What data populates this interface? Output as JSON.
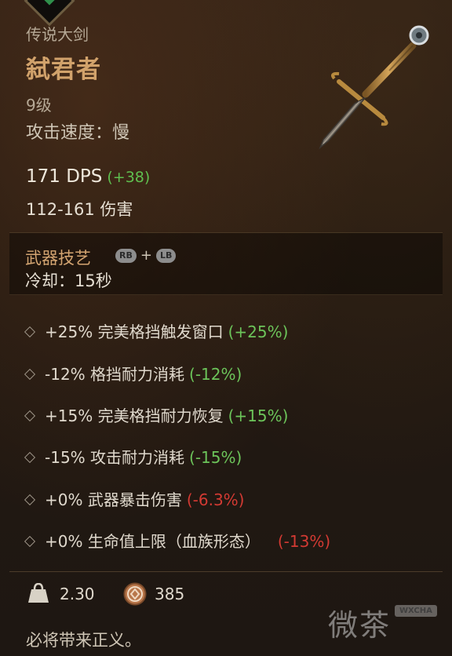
{
  "item": {
    "subtype": "传说大剑",
    "name": "弑君者",
    "level": "9级",
    "attack_speed": "攻击速度：慢",
    "dps": "171 DPS",
    "dps_bonus": "(+38)",
    "damage": "112-161 伤害"
  },
  "skill": {
    "title": "武器技艺",
    "button1": "RB",
    "plus": "+",
    "button2": "LB",
    "cooldown": "冷却：15秒"
  },
  "affixes": [
    {
      "text": "+25% 完美格挡触发窗口",
      "delta": "(+25%)",
      "delta_color": "#6cc45a"
    },
    {
      "text": "-12% 格挡耐力消耗",
      "delta": "(-12%)",
      "delta_color": "#6cc45a"
    },
    {
      "text": "+15% 完美格挡耐力恢复",
      "delta": "(+15%)",
      "delta_color": "#6cc45a"
    },
    {
      "text": "-15% 攻击耐力消耗",
      "delta": "(-15%)",
      "delta_color": "#6cc45a"
    },
    {
      "text": "+0% 武器暴击伤害",
      "delta": "(-6.3%)",
      "delta_color": "#d33a33"
    },
    {
      "text": "+0% 生命值上限（血族形态）",
      "delta": "(-13%)",
      "delta_color": "#d33a33"
    }
  ],
  "footer": {
    "weight": "2.30",
    "value": "385",
    "flavor": "必将带来正义。"
  },
  "watermark": {
    "text": "微茶",
    "badge": "WXCHA"
  },
  "icons": {
    "weight": "weight-icon",
    "currency": "coin-icon",
    "sword": "greatsword-icon"
  }
}
